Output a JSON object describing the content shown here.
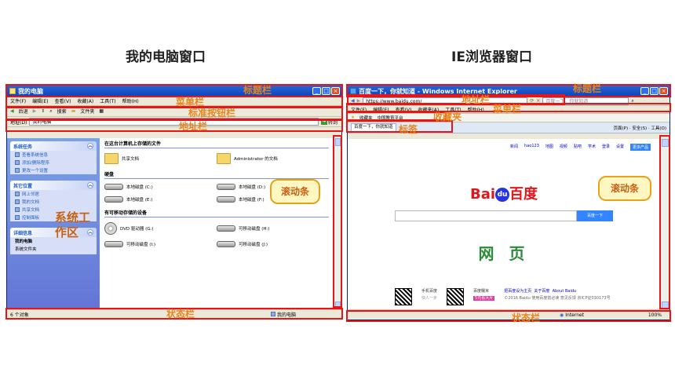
{
  "headings": {
    "left": "我的电脑窗口",
    "right": "IE浏览器窗口"
  },
  "annotations": {
    "title_bar": "标题栏",
    "menu_bar": "菜单栏",
    "standard_buttons": "标准按钮栏",
    "address_bar": "地址栏",
    "scrollbar": "滚动条",
    "system_work_area": "系统工作区",
    "status_bar": "状态栏",
    "favorites_bar": "收藏夹",
    "tab": "标签"
  },
  "mycomputer": {
    "title": "我的电脑",
    "menu": [
      "文件(F)",
      "编辑(E)",
      "查看(V)",
      "收藏(A)",
      "工具(T)",
      "帮助(H)"
    ],
    "toolbar": {
      "back": "后退",
      "search": "搜索",
      "folders": "文件夹"
    },
    "address": {
      "label": "地址(D)",
      "value": "我的电脑",
      "go": "转到"
    },
    "sidebar": {
      "system_tasks": {
        "title": "系统任务",
        "items": [
          "查看系统信息",
          "添加/删除程序",
          "更改一个设置"
        ]
      },
      "other_places": {
        "title": "其它位置",
        "items": [
          "网上邻居",
          "我的文档",
          "共享文档",
          "控制面板"
        ]
      },
      "details": {
        "title": "详细信息",
        "name": "我的电脑",
        "desc": "系统文件夹"
      }
    },
    "sections": {
      "stored": {
        "title": "在这台计算机上存储的文件",
        "items": [
          "共享文档",
          "Administrator 的文档"
        ]
      },
      "drives": {
        "title": "硬盘",
        "items": [
          "本地磁盘 (C:)",
          "本地磁盘 (D:)",
          "本地磁盘 (E:)",
          "本地磁盘 (F:)"
        ]
      },
      "removable": {
        "title": "有可移动存储的设备",
        "items": [
          "DVD 驱动器 (G:)",
          "可移动磁盘 (H:)",
          "可移动磁盘 (I:)",
          "可移动磁盘 (J:)"
        ]
      }
    },
    "status": {
      "left": "6 个对象",
      "right": "我的电脑"
    }
  },
  "ie": {
    "title": "百度一下，你就知道 - Windows Internet Explorer",
    "address": "https://www.baidu.com/",
    "search_placeholder": "百度一下，你就知道",
    "menu": [
      "文件(F)",
      "编辑(E)",
      "查看(V)",
      "收藏夹(A)",
      "工具(T)",
      "帮助(H)"
    ],
    "favorites": [
      "收藏夹",
      "中国教育平台"
    ],
    "tab_label": "百度一下，你就知道",
    "tab_tools": "页面(P) · 安全(S) · 工具(O)",
    "baidu_links": [
      "新闻",
      "hao123",
      "地图",
      "视频",
      "贴吧",
      "学术",
      "登录",
      "设置"
    ],
    "more_products": "更多产品",
    "logo": {
      "bai": "Bai",
      "du": "du",
      "cn": "百度"
    },
    "search_button": "百度一下",
    "page_label": "网 页",
    "footer": {
      "mobile": "手机百度",
      "mobile_sub": "快人一步",
      "edu": "百度糯米",
      "edu_tag": "5元看大片",
      "links": [
        "把百度设为主页",
        "关于百度",
        "About Baidu"
      ],
      "copyright": "©2016 Baidu 使用百度前必读 意见反馈 京ICP证030173号"
    },
    "status": {
      "zone": "Internet",
      "zoom": "100%"
    }
  }
}
